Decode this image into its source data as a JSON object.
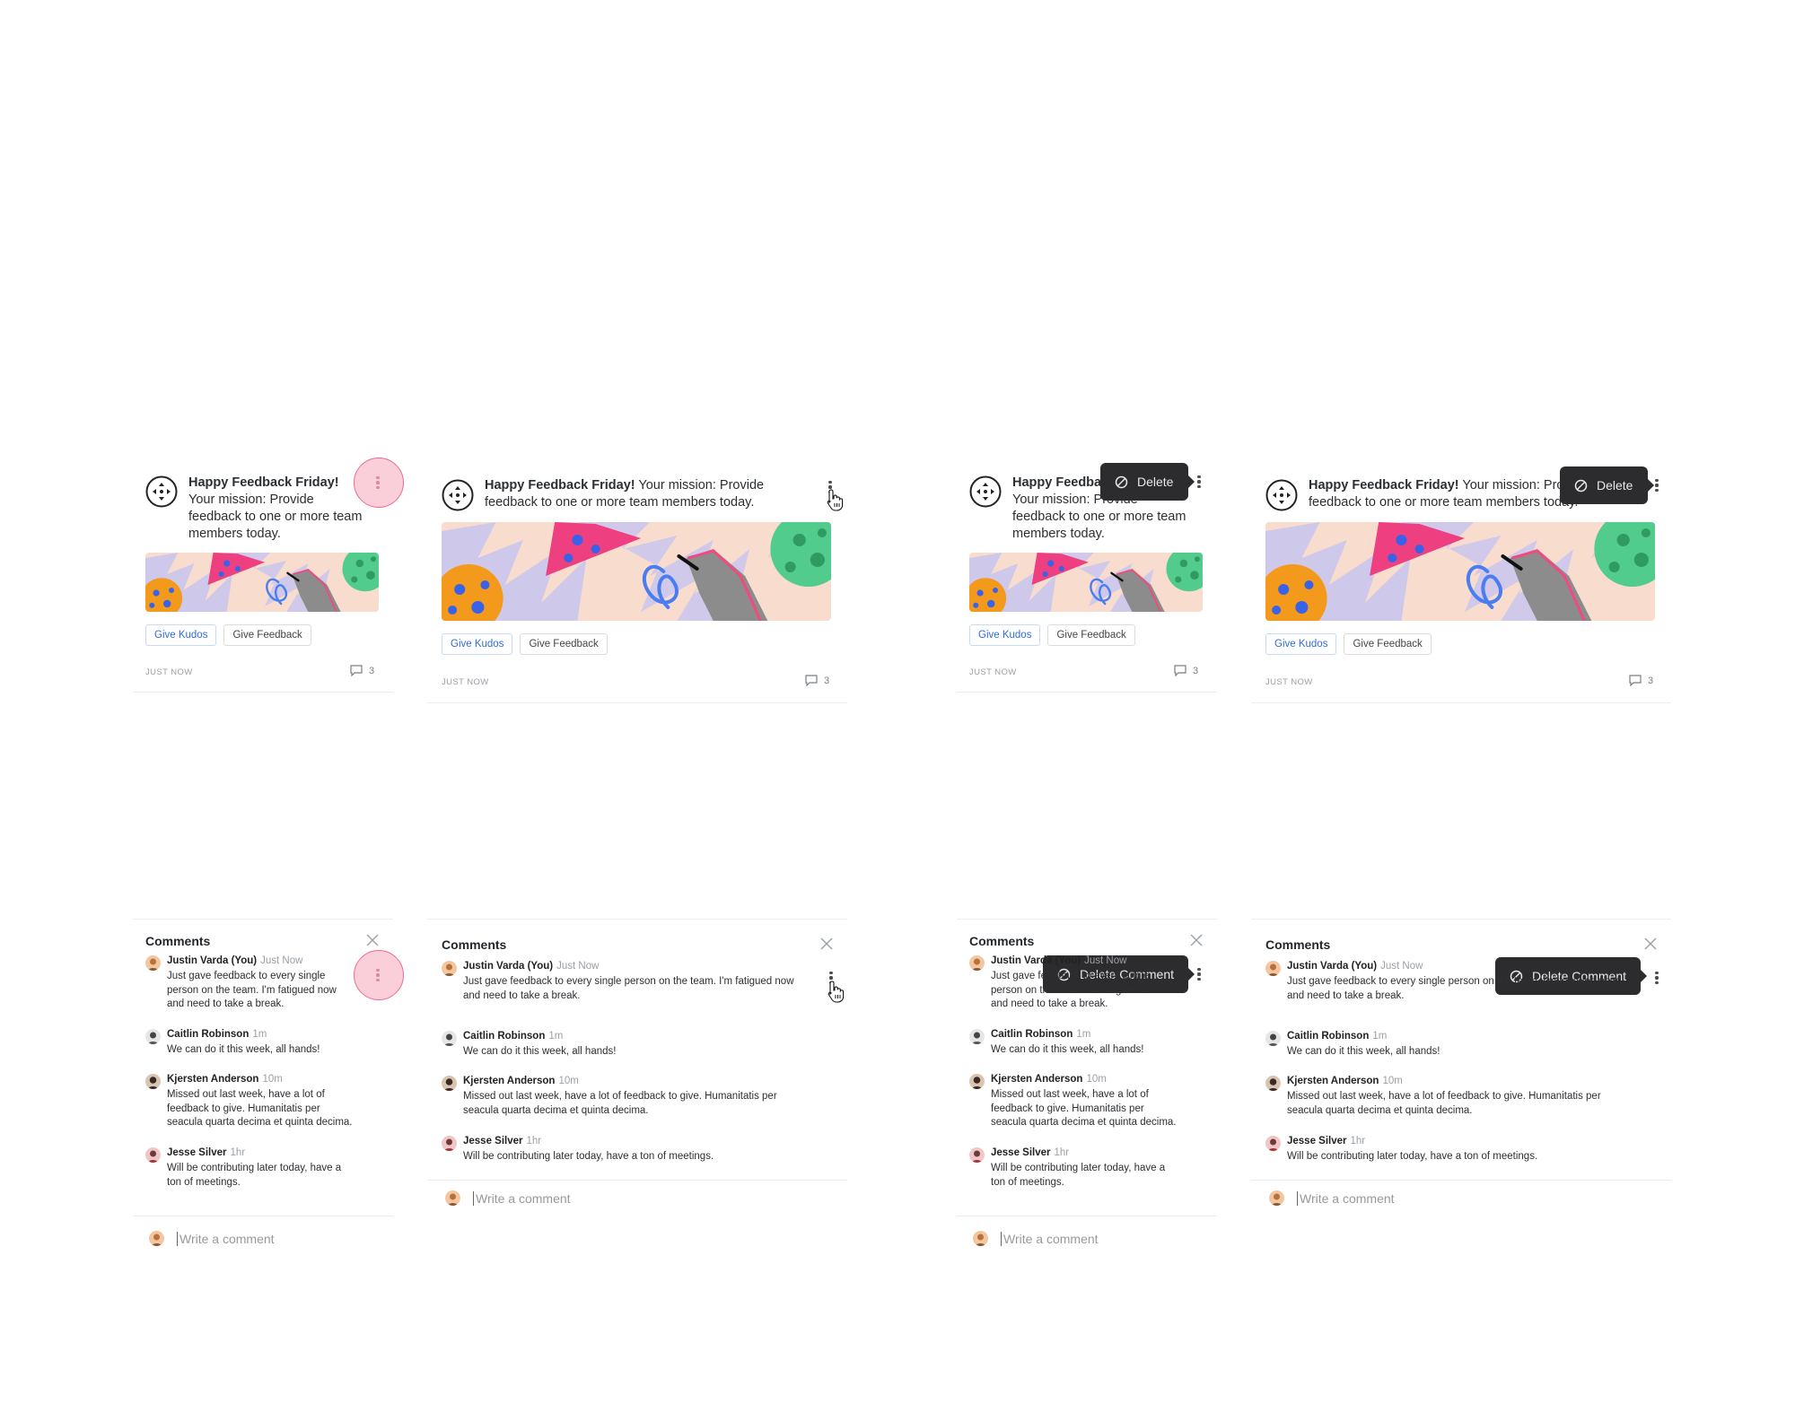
{
  "post": {
    "title": "Happy Feedback Friday!",
    "message": "Your mission: Provide feedback to one or more team members today.",
    "tags": [
      "Give Kudos",
      "Give Feedback"
    ],
    "time": "JUST NOW",
    "comment_count": "3"
  },
  "delete_label": "Delete",
  "delete_comment_label": "Delete Comment",
  "comments_panel": {
    "title": "Comments",
    "placeholder": "Write a comment",
    "comments": [
      {
        "author": "Justin Varda (You)",
        "time": "Just Now",
        "text": "Just gave feedback to every single person on the team. I'm fatigued now and need to take a break."
      },
      {
        "author": "Caitlin Robinson",
        "time": "1m",
        "text": "We can do it this week, all hands!"
      },
      {
        "author": "Kjersten Anderson",
        "time": "10m",
        "text": "Missed out last week, have a lot of feedback to give. Humanitatis per seacula quarta decima et quinta decima."
      },
      {
        "author": "Jesse Silver",
        "time": "1hr",
        "text": "Will be contributing later today, have a ton of meetings."
      }
    ]
  },
  "colors": {
    "tooltip": "#2c2c2e",
    "halo": "#f7a8bc",
    "kudos": "#2f6be0"
  }
}
